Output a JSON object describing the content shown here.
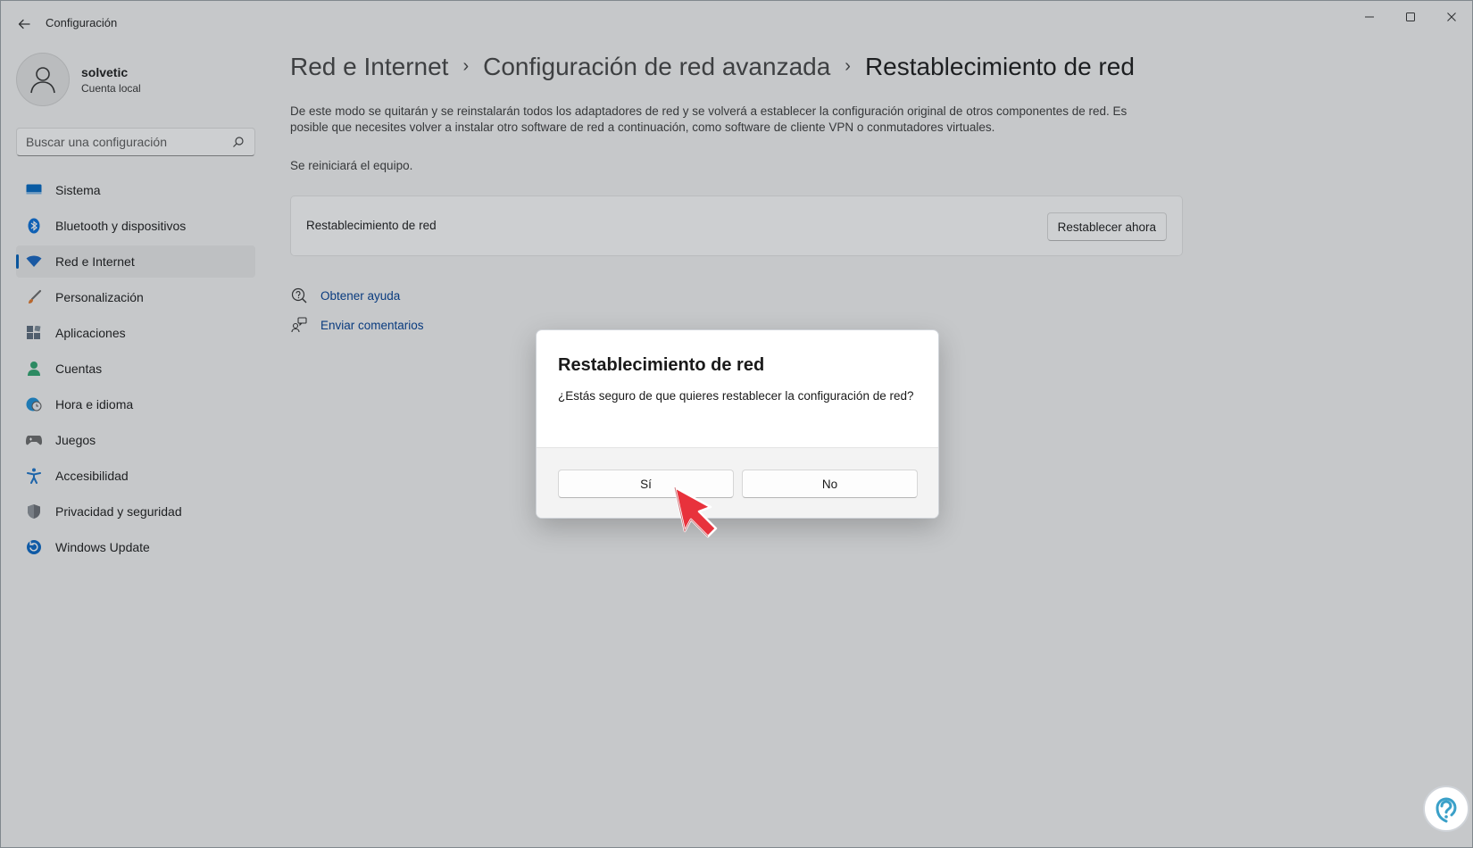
{
  "window": {
    "title": "Configuración",
    "back_icon": "back-arrow-icon",
    "controls": [
      "minimize-icon",
      "maximize-icon",
      "close-icon"
    ]
  },
  "profile": {
    "name": "solvetic",
    "account_type": "Cuenta local"
  },
  "search": {
    "placeholder": "Buscar una configuración"
  },
  "sidebar": {
    "items": [
      {
        "label": "Sistema",
        "icon": "monitor-icon",
        "color": "#0067c0"
      },
      {
        "label": "Bluetooth y dispositivos",
        "icon": "bluetooth-icon",
        "color": "#0a6fd8"
      },
      {
        "label": "Red e Internet",
        "icon": "wifi-icon",
        "color": "#1565c0",
        "active": true
      },
      {
        "label": "Personalización",
        "icon": "brush-icon",
        "color": "#e0762a"
      },
      {
        "label": "Aplicaciones",
        "icon": "apps-icon",
        "color": "#5b6b7b"
      },
      {
        "label": "Cuentas",
        "icon": "person-icon",
        "color": "#2ea36d"
      },
      {
        "label": "Hora e idioma",
        "icon": "globe-clock-icon",
        "color": "#1b8fd6"
      },
      {
        "label": "Juegos",
        "icon": "gamepad-icon",
        "color": "#6b6b6b"
      },
      {
        "label": "Accesibilidad",
        "icon": "accessibility-icon",
        "color": "#1a73c8"
      },
      {
        "label": "Privacidad y seguridad",
        "icon": "shield-icon",
        "color": "#6b6f75"
      },
      {
        "label": "Windows Update",
        "icon": "update-icon",
        "color": "#0a67c4"
      }
    ]
  },
  "breadcrumb": {
    "items": [
      "Red e Internet",
      "Configuración de red avanzada",
      "Restablecimiento de red"
    ]
  },
  "main": {
    "description": "De este modo se quitarán y se reinstalarán todos los adaptadores de red y se volverá a establecer la configuración original de otros componentes de red. Es posible que necesites volver a instalar otro software de red a continuación, como software de cliente VPN o conmutadores virtuales.",
    "restart_note": "Se reiniciará el equipo.",
    "card_label": "Restablecimiento de red",
    "card_button": "Restablecer ahora",
    "links": [
      {
        "label": "Obtener ayuda",
        "icon": "help-icon"
      },
      {
        "label": "Enviar comentarios",
        "icon": "feedback-icon"
      }
    ]
  },
  "dialog": {
    "title": "Restablecimiento de red",
    "message": "¿Estás seguro de que quieres restablecer la configuración de red?",
    "yes_label": "Sí",
    "no_label": "No"
  },
  "colors": {
    "accent": "#005fb8",
    "link": "#003e92",
    "cursor": "#e8323c"
  }
}
